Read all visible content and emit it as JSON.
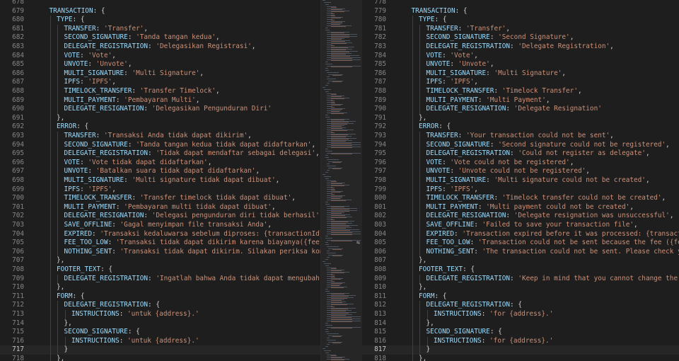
{
  "left": {
    "lines": [
      {
        "n": "678",
        "indent": 0,
        "key": "",
        "val": "",
        "tail": ""
      },
      {
        "n": "679",
        "indent": 1,
        "key": "TRANSACTION",
        "val": "",
        "tail": ": {"
      },
      {
        "n": "680",
        "indent": 2,
        "key": "TYPE",
        "val": "",
        "tail": ": {"
      },
      {
        "n": "681",
        "indent": 3,
        "key": "TRANSFER",
        "val": "'Transfer'",
        "tail": ","
      },
      {
        "n": "682",
        "indent": 3,
        "key": "SECOND_SIGNATURE",
        "val": "'Tanda tangan kedua'",
        "tail": ","
      },
      {
        "n": "683",
        "indent": 3,
        "key": "DELEGATE_REGISTRATION",
        "val": "'Delegasikan Registrasi'",
        "tail": ","
      },
      {
        "n": "684",
        "indent": 3,
        "key": "VOTE",
        "val": "'Vote'",
        "tail": ","
      },
      {
        "n": "685",
        "indent": 3,
        "key": "UNVOTE",
        "val": "'Unvote'",
        "tail": ","
      },
      {
        "n": "686",
        "indent": 3,
        "key": "MULTI_SIGNATURE",
        "val": "'Multi Signature'",
        "tail": ","
      },
      {
        "n": "687",
        "indent": 3,
        "key": "IPFS",
        "val": "'IPFS'",
        "tail": ","
      },
      {
        "n": "688",
        "indent": 3,
        "key": "TIMELOCK_TRANSFER",
        "val": "'Transfer Timelock'",
        "tail": ","
      },
      {
        "n": "689",
        "indent": 3,
        "key": "MULTI_PAYMENT",
        "val": "'Pembayaran Multi'",
        "tail": ","
      },
      {
        "n": "690",
        "indent": 3,
        "key": "DELEGATE_RESIGNATION",
        "val": "'Delegasikan Pengunduran Diri'",
        "tail": ""
      },
      {
        "n": "691",
        "indent": 2,
        "key": "",
        "val": "",
        "tail": "},"
      },
      {
        "n": "692",
        "indent": 2,
        "key": "ERROR",
        "val": "",
        "tail": ": {"
      },
      {
        "n": "693",
        "indent": 3,
        "key": "TRANSFER",
        "val": "'Transaksi Anda tidak dapat dikirim'",
        "tail": ","
      },
      {
        "n": "694",
        "indent": 3,
        "key": "SECOND_SIGNATURE",
        "val": "'Tanda tangan kedua tidak dapat didaftarkan'",
        "tail": ","
      },
      {
        "n": "695",
        "indent": 3,
        "key": "DELEGATE_REGISTRATION",
        "val": "'Tidak dapat mendaftar sebagai delegasi'",
        "tail": ","
      },
      {
        "n": "696",
        "indent": 3,
        "key": "VOTE",
        "val": "'Vote tidak dapat didaftarkan'",
        "tail": ","
      },
      {
        "n": "697",
        "indent": 3,
        "key": "UNVOTE",
        "val": "'Batalkan suara tidak dapat didaftarkan'",
        "tail": ","
      },
      {
        "n": "698",
        "indent": 3,
        "key": "MULTI_SIGNATURE",
        "val": "'Multi signature tidak dapat dibuat'",
        "tail": ","
      },
      {
        "n": "699",
        "indent": 3,
        "key": "IPFS",
        "val": "'IPFS'",
        "tail": ","
      },
      {
        "n": "700",
        "indent": 3,
        "key": "TIMELOCK_TRANSFER",
        "val": "'Transfer timelock tidak dapat dibuat'",
        "tail": ","
      },
      {
        "n": "701",
        "indent": 3,
        "key": "MULTI_PAYMENT",
        "val": "'Pembayaran multi tidak dapat dibuat'",
        "tail": ","
      },
      {
        "n": "702",
        "indent": 3,
        "key": "DELEGATE_RESIGNATION",
        "val": "'Delegasi pengunduran diri tidak berhasil'",
        "tail": ","
      },
      {
        "n": "703",
        "indent": 3,
        "key": "SAVE_OFFLINE",
        "val": "'Gagal menyimpan file transaksi Anda'",
        "tail": ","
      },
      {
        "n": "704",
        "indent": 3,
        "key": "EXPIRED",
        "val": "'Transaksi kedaluwarsa sebelum diproses: {transactionId}'",
        "tail": ","
      },
      {
        "n": "705",
        "indent": 3,
        "key": "FEE_TOO_LOW",
        "val": "'Transaksi tidak dapat dikirim karena biayanya({fee}) terlal",
        "tail": ""
      },
      {
        "n": "706",
        "indent": 3,
        "key": "NOTHING_SENT",
        "val": "'Transaksi tidak dapat dikirim. Silakan periksa koneksi jar",
        "tail": ""
      },
      {
        "n": "707",
        "indent": 2,
        "key": "",
        "val": "",
        "tail": "},"
      },
      {
        "n": "708",
        "indent": 2,
        "key": "FOOTER_TEXT",
        "val": "",
        "tail": ": {"
      },
      {
        "n": "709",
        "indent": 3,
        "key": "DELEGATE_REGISTRATION",
        "val": "'Ingatlah bahwa Anda tidak dapat mengubah nama del",
        "tail": ""
      },
      {
        "n": "710",
        "indent": 2,
        "key": "",
        "val": "",
        "tail": "},"
      },
      {
        "n": "711",
        "indent": 2,
        "key": "FORM",
        "val": "",
        "tail": ": {"
      },
      {
        "n": "712",
        "indent": 3,
        "key": "DELEGATE_REGISTRATION",
        "val": "",
        "tail": ": {"
      },
      {
        "n": "713",
        "indent": 4,
        "key": "INSTRUCTIONS",
        "val": "'untuk {address}.'",
        "tail": ""
      },
      {
        "n": "714",
        "indent": 3,
        "key": "",
        "val": "",
        "tail": "},"
      },
      {
        "n": "715",
        "indent": 3,
        "key": "SECOND_SIGNATURE",
        "val": "",
        "tail": ": {"
      },
      {
        "n": "716",
        "indent": 4,
        "key": "INSTRUCTIONS",
        "val": "'untuk {address}.'",
        "tail": ""
      },
      {
        "n": "717",
        "indent": 3,
        "key": "",
        "val": "",
        "tail": "}"
      },
      {
        "n": "718",
        "indent": 2,
        "key": "",
        "val": "",
        "tail": "},"
      }
    ]
  },
  "right": {
    "lines": [
      {
        "n": "778",
        "indent": 0,
        "key": "",
        "val": "",
        "tail": ""
      },
      {
        "n": "779",
        "indent": 1,
        "key": "TRANSACTION",
        "val": "",
        "tail": ": {"
      },
      {
        "n": "780",
        "indent": 2,
        "key": "TYPE",
        "val": "",
        "tail": ": {"
      },
      {
        "n": "781",
        "indent": 3,
        "key": "TRANSFER",
        "val": "'Transfer'",
        "tail": ","
      },
      {
        "n": "782",
        "indent": 3,
        "key": "SECOND_SIGNATURE",
        "val": "'Second Signature'",
        "tail": ","
      },
      {
        "n": "783",
        "indent": 3,
        "key": "DELEGATE_REGISTRATION",
        "val": "'Delegate Registration'",
        "tail": ","
      },
      {
        "n": "784",
        "indent": 3,
        "key": "VOTE",
        "val": "'Vote'",
        "tail": ","
      },
      {
        "n": "785",
        "indent": 3,
        "key": "UNVOTE",
        "val": "'Unvote'",
        "tail": ","
      },
      {
        "n": "786",
        "indent": 3,
        "key": "MULTI_SIGNATURE",
        "val": "'Multi Signature'",
        "tail": ","
      },
      {
        "n": "787",
        "indent": 3,
        "key": "IPFS",
        "val": "'IPFS'",
        "tail": ","
      },
      {
        "n": "788",
        "indent": 3,
        "key": "TIMELOCK_TRANSFER",
        "val": "'Timelock Transfer'",
        "tail": ","
      },
      {
        "n": "789",
        "indent": 3,
        "key": "MULTI_PAYMENT",
        "val": "'Multi Payment'",
        "tail": ","
      },
      {
        "n": "790",
        "indent": 3,
        "key": "DELEGATE_RESIGNATION",
        "val": "'Delegate Resignation'",
        "tail": ""
      },
      {
        "n": "791",
        "indent": 2,
        "key": "",
        "val": "",
        "tail": "},"
      },
      {
        "n": "792",
        "indent": 2,
        "key": "ERROR",
        "val": "",
        "tail": ": {"
      },
      {
        "n": "793",
        "indent": 3,
        "key": "TRANSFER",
        "val": "'Your transaction could not be sent'",
        "tail": ","
      },
      {
        "n": "794",
        "indent": 3,
        "key": "SECOND_SIGNATURE",
        "val": "'Second signature could not be registered'",
        "tail": ","
      },
      {
        "n": "795",
        "indent": 3,
        "key": "DELEGATE_REGISTRATION",
        "val": "'Could not register as delegate'",
        "tail": ","
      },
      {
        "n": "796",
        "indent": 3,
        "key": "VOTE",
        "val": "'Vote could not be registered'",
        "tail": ","
      },
      {
        "n": "797",
        "indent": 3,
        "key": "UNVOTE",
        "val": "'Unvote could not be registered'",
        "tail": ","
      },
      {
        "n": "798",
        "indent": 3,
        "key": "MULTI_SIGNATURE",
        "val": "'Multi signature could not be created'",
        "tail": ","
      },
      {
        "n": "799",
        "indent": 3,
        "key": "IPFS",
        "val": "'IPFS'",
        "tail": ","
      },
      {
        "n": "800",
        "indent": 3,
        "key": "TIMELOCK_TRANSFER",
        "val": "'Timelock transfer could not be created'",
        "tail": ","
      },
      {
        "n": "801",
        "indent": 3,
        "key": "MULTI_PAYMENT",
        "val": "'Multi payment could not be created'",
        "tail": ","
      },
      {
        "n": "802",
        "indent": 3,
        "key": "DELEGATE_RESIGNATION",
        "val": "'Delegate resignation was unsuccessful'",
        "tail": ","
      },
      {
        "n": "803",
        "indent": 3,
        "key": "SAVE_OFFLINE",
        "val": "'Failed to save your transaction file'",
        "tail": ","
      },
      {
        "n": "804",
        "indent": 3,
        "key": "EXPIRED",
        "val": "'Transaction expired before it was processed: {transactionId}'",
        "tail": ","
      },
      {
        "n": "805",
        "indent": 3,
        "key": "FEE_TOO_LOW",
        "val": "'Transaction could not be sent because the fee ({fee}) is to",
        "tail": ""
      },
      {
        "n": "806",
        "indent": 3,
        "key": "NOTHING_SENT",
        "val": "'The transaction could not be sent. Please check your netwo",
        "tail": ""
      },
      {
        "n": "807",
        "indent": 2,
        "key": "",
        "val": "",
        "tail": "},"
      },
      {
        "n": "808",
        "indent": 2,
        "key": "FOOTER_TEXT",
        "val": "",
        "tail": ": {"
      },
      {
        "n": "809",
        "indent": 3,
        "key": "DELEGATE_REGISTRATION",
        "val": "'Keep in mind that you cannot change the name of y",
        "tail": ""
      },
      {
        "n": "810",
        "indent": 2,
        "key": "",
        "val": "",
        "tail": "},"
      },
      {
        "n": "811",
        "indent": 2,
        "key": "FORM",
        "val": "",
        "tail": ": {"
      },
      {
        "n": "812",
        "indent": 3,
        "key": "DELEGATE_REGISTRATION",
        "val": "",
        "tail": ": {"
      },
      {
        "n": "813",
        "indent": 4,
        "key": "INSTRUCTIONS",
        "val": "'for {address}.'",
        "tail": ""
      },
      {
        "n": "814",
        "indent": 3,
        "key": "",
        "val": "",
        "tail": "},"
      },
      {
        "n": "815",
        "indent": 3,
        "key": "SECOND_SIGNATURE",
        "val": "",
        "tail": ": {"
      },
      {
        "n": "816",
        "indent": 4,
        "key": "INSTRUCTIONS",
        "val": "'for {address}.'",
        "tail": ""
      },
      {
        "n": "817",
        "indent": 3,
        "key": "",
        "val": "",
        "tail": "}"
      },
      {
        "n": "818",
        "indent": 2,
        "key": "",
        "val": "",
        "tail": "},"
      }
    ]
  },
  "current_line_left": "717",
  "current_line_right": "817",
  "colors": {
    "key": "#9cdcfe",
    "string": "#ce9178",
    "punct": "#d4d4d4",
    "gutter": "#858585",
    "bg": "#1e1e1e"
  }
}
